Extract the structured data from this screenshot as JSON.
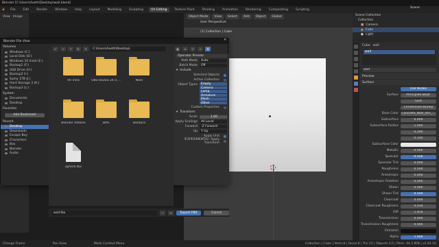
{
  "window": {
    "title": "Blender [C:\\Users\\Axeth\\Desktop\\wall.blend]"
  },
  "menubar": {
    "items": [
      "File",
      "Edit",
      "Render",
      "Window",
      "Help"
    ],
    "workspaces": [
      "Layout",
      "Modeling",
      "Sculpting",
      "UV Editing",
      "Texture Paint",
      "Shading",
      "Animation",
      "Rendering",
      "Compositing",
      "Scripting"
    ],
    "active_workspace": "UV Editing"
  },
  "left_view": {
    "tabs": [
      "View",
      "Image"
    ]
  },
  "viewport": {
    "mode": "Object Mode",
    "menus": [
      "View",
      "Select",
      "Add",
      "Object"
    ],
    "orientation": "Global",
    "info_line1": "User Perspective",
    "info_line2": "(1) Collection | Cube"
  },
  "outliner": {
    "title": "Scene Collection",
    "rows": [
      "Collection",
      "Camera",
      "Cube",
      "Light"
    ],
    "scene": "Scene",
    "view_layer": "View Layer"
  },
  "properties": {
    "object_name": "Cube",
    "material_name": "wall",
    "slot_name": "wall",
    "sections": [
      "Preview",
      "Surface"
    ],
    "use_nodes": "Use Nodes",
    "rows": [
      {
        "label": "Surface",
        "value": "Principled BSDF"
      },
      {
        "label": "",
        "value": "GGX"
      },
      {
        "label": "",
        "value": "Christensen-Burley"
      },
      {
        "label": "Base Color",
        "value": "Concrete_Wall_001_..."
      },
      {
        "label": "Subsurface",
        "value": "0.000"
      },
      {
        "label": "Subsurface Radius",
        "value": "1.000"
      },
      {
        "label": "",
        "value": "0.200"
      },
      {
        "label": "",
        "value": "0.100"
      },
      {
        "label": "Subsurface Color",
        "value": ""
      },
      {
        "label": "Metallic",
        "value": "0.000"
      },
      {
        "label": "Specular",
        "value": "0.500"
      },
      {
        "label": "Specular Tint",
        "value": "0.000"
      },
      {
        "label": "Roughness",
        "value": "0.500"
      },
      {
        "label": "Anisotropic",
        "value": "0.000"
      },
      {
        "label": "Anisotropic Rotation",
        "value": "0.000"
      },
      {
        "label": "Sheen",
        "value": "0.000"
      },
      {
        "label": "Sheen Tint",
        "value": "0.500"
      },
      {
        "label": "Clearcoat",
        "value": "0.000"
      },
      {
        "label": "Clearcoat Roughness",
        "value": "0.030"
      },
      {
        "label": "IOR",
        "value": "1.450"
      },
      {
        "label": "Transmission",
        "value": "0.000"
      },
      {
        "label": "Transmission Roughness",
        "value": "0.000"
      },
      {
        "label": "Emission",
        "value": ""
      },
      {
        "label": "Alpha",
        "value": "1.000"
      }
    ]
  },
  "file_browser": {
    "title": "Blender File View",
    "path": "C:\\Users\\Axeth\\Desktop\\",
    "filename": "wall.fbx",
    "export_label": "Export FBX",
    "cancel_label": "Cancel",
    "volumes_title": "Volumes",
    "volumes": [
      "Windows (C:)",
      "Local Disk (D:)",
      "Windows 10 Insid (E:)",
      "Backup1 (F:)",
      "USB Drive (H:)",
      "Backup2 (I:)",
      "Samy 1TB (J:)",
      "Hard Storage 3 (K:)",
      "Backup3 (L:)"
    ],
    "system_title": "System",
    "system": [
      "Documents",
      "Desktop"
    ],
    "favorites_title": "Favorites",
    "add_bookmark": "Add Bookmark",
    "recent_title": "Recent",
    "recent": [
      "Desktop",
      "Downloads",
      "Escape Boy",
      "Characters",
      "Box",
      "Blender",
      "Audio"
    ],
    "files": [
      {
        "name": "VR Intro",
        "kind": "folder"
      },
      {
        "name": "OBS-Studio-24.0.3-Full-x64",
        "kind": "folder"
      },
      {
        "name": "Noel",
        "kind": "folder"
      },
      {
        "name": "Blender Addons",
        "kind": "folder"
      },
      {
        "name": "BIPE",
        "kind": "folder"
      },
      {
        "name": "Barbara",
        "kind": "folder"
      },
      {
        "name": "sphere.fbx",
        "kind": "file"
      }
    ],
    "operator_presets": "Operator Presets",
    "path_mode_label": "Path Mode",
    "path_mode": "Auto",
    "batch_mode_label": "Batch Mode",
    "batch_mode": "Off",
    "include_title": "Include",
    "selected_objects": "Selected Objects",
    "active_collection": "Active Collection",
    "object_types_label": "Object Types",
    "object_types": [
      "Empty",
      "Camera",
      "Lamp",
      "Armature",
      "Mesh",
      "Other"
    ],
    "custom_properties": "Custom Properties",
    "transform_title": "Transform",
    "scale_label": "Scale",
    "scale": "1.00",
    "apply_scalings_label": "Apply Scalings",
    "apply_scalings": "All Local",
    "forward_label": "Forward",
    "forward": "-Z Forward",
    "up_label": "Up",
    "up": "Y Up",
    "apply_unit": "Apply Unit",
    "experimental": "!EXPERIMENTAL! Apply Transform"
  },
  "statusbar": {
    "left": "Change Frame",
    "mid": "Pan View",
    "mid2": "Mask Context Menu",
    "right": "Collection | Cube | Verts:8 | Faces:6 | Tris:12 | Objects:1/3 | Mem: 44.3 MiB | v2.81.16"
  }
}
